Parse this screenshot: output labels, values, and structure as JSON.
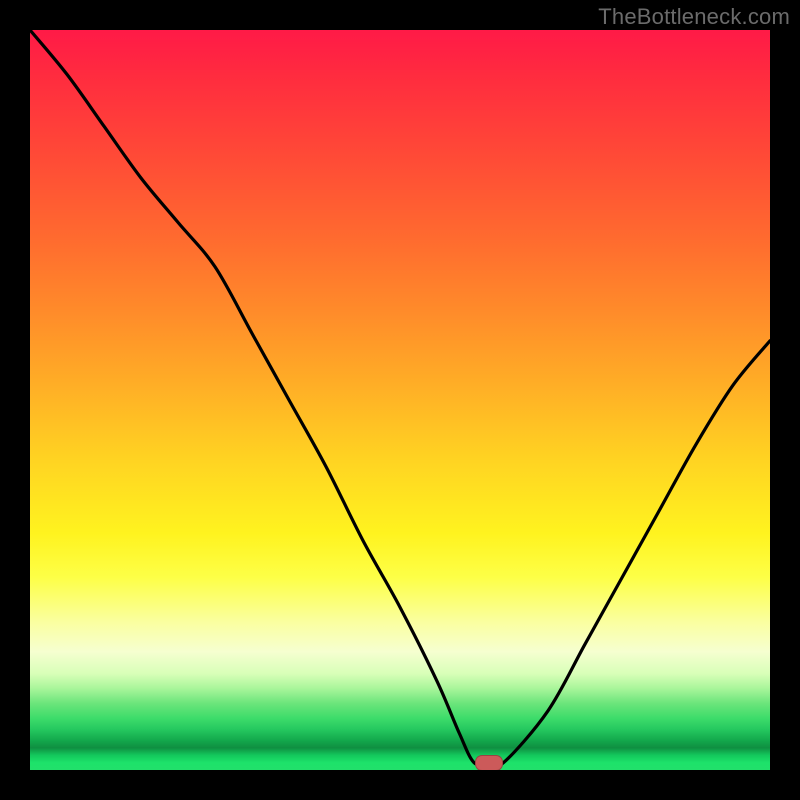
{
  "watermark": "TheBottleneck.com",
  "chart_data": {
    "type": "line",
    "title": "",
    "xlabel": "",
    "ylabel": "",
    "xlim": [
      0,
      100
    ],
    "ylim": [
      0,
      100
    ],
    "background": "rainbow_vertical_gradient",
    "grid": false,
    "legend": false,
    "series": [
      {
        "name": "curve",
        "x": [
          0,
          5,
          10,
          15,
          20,
          25,
          30,
          35,
          40,
          45,
          50,
          55,
          58,
          60,
          62,
          64,
          70,
          75,
          80,
          85,
          90,
          95,
          100
        ],
        "values": [
          100,
          94,
          87,
          80,
          74,
          68,
          59,
          50,
          41,
          31,
          22,
          12,
          5,
          1,
          1,
          1,
          8,
          17,
          26,
          35,
          44,
          52,
          58
        ]
      }
    ],
    "marker": {
      "x": 62,
      "y": 1,
      "shape": "pill",
      "color": "#cc5a5a"
    },
    "flat_segment": {
      "x_start": 58,
      "x_end": 64,
      "y": 1
    }
  },
  "colors": {
    "frame": "#000000",
    "curve": "#000000",
    "watermark": "#6b6b6b"
  }
}
